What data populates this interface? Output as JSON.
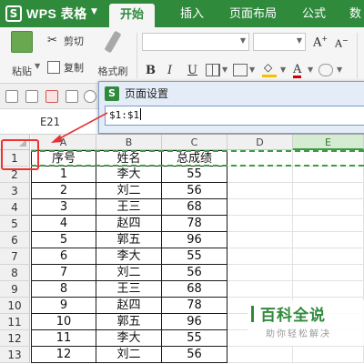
{
  "app": {
    "name": "WPS 表格",
    "logo": "S"
  },
  "tabs": [
    {
      "label": "开始",
      "active": true
    },
    {
      "label": "插入"
    },
    {
      "label": "页面布局"
    },
    {
      "label": "公式"
    },
    {
      "label": "数"
    }
  ],
  "ribbon": {
    "paste": "粘贴",
    "cut": "剪切",
    "copy": "复制",
    "format_painter": "格式刷",
    "bold": "B",
    "italic": "I",
    "underline": "U",
    "font_inc": "A",
    "font_dec": "A"
  },
  "formula_bar": {
    "name_box": "E21"
  },
  "dialog": {
    "title": "页面设置",
    "logo": "S",
    "value": "$1:$1"
  },
  "sheet": {
    "columns": [
      "A",
      "B",
      "C",
      "D",
      "E"
    ],
    "selected_column": "E",
    "row_numbers": [
      "1",
      "2",
      "3",
      "4",
      "5",
      "6",
      "7",
      "8",
      "9",
      "10",
      "11",
      "12",
      "13"
    ],
    "header": [
      "序号",
      "姓名",
      "总成绩"
    ],
    "rows": [
      [
        "1",
        "李大",
        "55"
      ],
      [
        "2",
        "刘二",
        "56"
      ],
      [
        "3",
        "王三",
        "68"
      ],
      [
        "4",
        "赵四",
        "78"
      ],
      [
        "5",
        "郭五",
        "96"
      ],
      [
        "6",
        "李大",
        "55"
      ],
      [
        "7",
        "刘二",
        "56"
      ],
      [
        "8",
        "王三",
        "68"
      ],
      [
        "9",
        "赵四",
        "78"
      ],
      [
        "10",
        "郭五",
        "96"
      ],
      [
        "11",
        "李大",
        "55"
      ],
      [
        "12",
        "刘二",
        "56"
      ]
    ]
  },
  "watermark": {
    "main": "百科全说",
    "sub": "助你轻松解决"
  },
  "colors": {
    "brand": "#2f8a3c",
    "annotation": "#e33333",
    "marquee": "#3c9b45"
  }
}
